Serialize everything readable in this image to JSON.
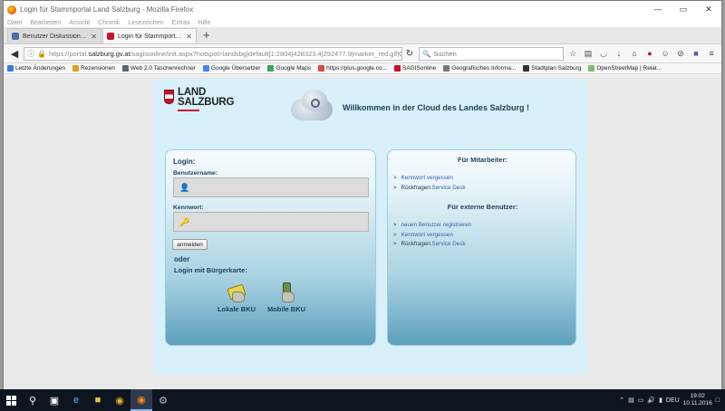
{
  "window": {
    "title": "Login für Stammportal Land Salzburg - Mozilla Firefox",
    "controls": [
      "—",
      "▭",
      "✕"
    ]
  },
  "menu": [
    "Datei",
    "Bearbeiten",
    "Ansicht",
    "Chronik",
    "Lesezeichen",
    "Extras",
    "Hilfe"
  ],
  "tabs": [
    {
      "label": "Benutzer Diskussion:Asterix...",
      "icon_color": "#4a6fa5",
      "active": false
    },
    {
      "label": "Login für Stammportal Land S...",
      "icon_color": "#c8102e",
      "active": true
    }
  ],
  "nav": {
    "url_prefix": "https://portal.",
    "url_domain": "salzburg.gv.at",
    "url_rest": "/sagisonline/init.aspx?hotspot=landsbg|default|1:2804|428323.4|292477.9|marker_red.gif|Oberdosserw",
    "search_placeholder": "Suchen"
  },
  "bookmarks": [
    {
      "label": "Letzte Änderungen",
      "color": "#3b7bd8"
    },
    {
      "label": "Rezensionen",
      "color": "#e0a020"
    },
    {
      "label": "Web 2.0 Taschenrechner",
      "color": "#556677"
    },
    {
      "label": "Google Übersetzer",
      "color": "#4285f4"
    },
    {
      "label": "Google Maps",
      "color": "#34a853"
    },
    {
      "label": "https://plus.google.co...",
      "color": "#dd4b39"
    },
    {
      "label": "SAGISonline",
      "color": "#c8102e"
    },
    {
      "label": "Geografisches Informa...",
      "color": "#777777"
    },
    {
      "label": "Stadtplan Salzburg",
      "color": "#333333"
    },
    {
      "label": "OpenStreetMap | Relat...",
      "color": "#7ebc6f"
    }
  ],
  "portal": {
    "logo_line1": "LAND",
    "logo_line2": "SALZBURG",
    "welcome": "Willkommen in der Cloud des Landes Salzburg !",
    "login": {
      "title": "Login:",
      "username_label": "Benutzername:",
      "password_label": "Kennwort:",
      "submit": "anmelden",
      "oder": "oder",
      "buergerkarte": "Login mit Bürgerkarte:",
      "bku_local": "Lokale BKU",
      "bku_mobile": "Mobile BKU"
    },
    "staff": {
      "title": "Für Mitarbeiter:",
      "links": [
        {
          "prefix": "",
          "link": "Kennwort vergessen"
        },
        {
          "prefix": "Rückfragen:",
          "link": "Service Desk"
        }
      ]
    },
    "external": {
      "title": "Für externe Benutzer:",
      "links": [
        {
          "prefix": "",
          "link": "neuen Benutzer registrieren"
        },
        {
          "prefix": "",
          "link": "Kennwort vergessen"
        },
        {
          "prefix": "Rückfragen:",
          "link": "Service Desk"
        }
      ]
    }
  },
  "taskbar": {
    "language": "DEU",
    "time": "19:02",
    "date": "10.11.2016"
  }
}
